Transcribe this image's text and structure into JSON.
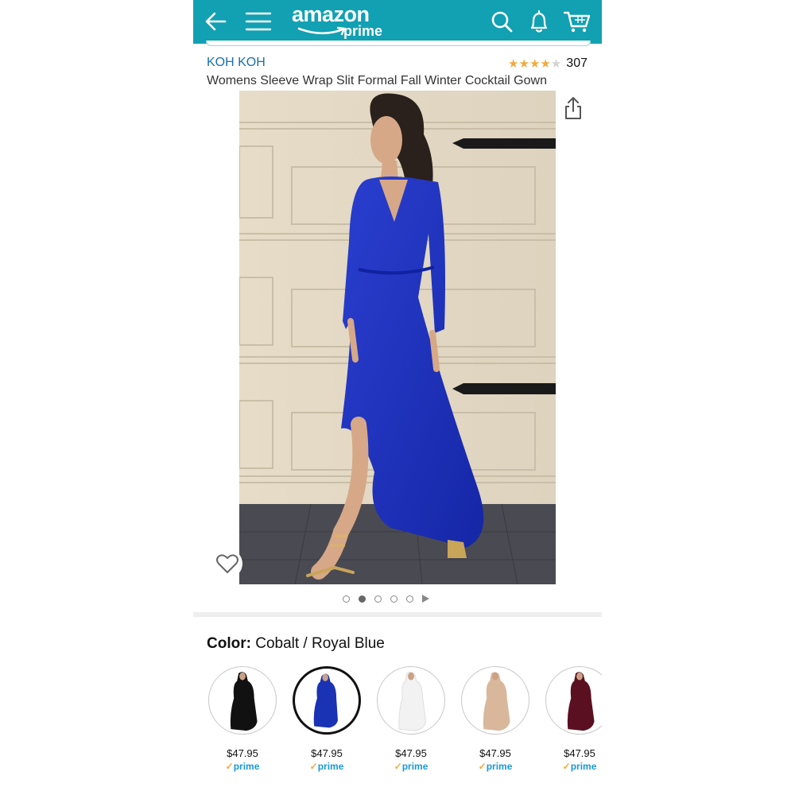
{
  "header": {
    "logo_word": "amazon",
    "logo_sub": "prime",
    "icons": [
      "back-arrow-icon",
      "menu-icon",
      "search-icon",
      "bell-icon",
      "cart-icon"
    ],
    "bg_color": "#12a0b3"
  },
  "product": {
    "brand": "KOH KOH",
    "rating_stars": 4,
    "rating_max": 5,
    "review_count": "307",
    "title": "Womens Sleeve Wrap Slit Formal Fall Winter Cocktail Gown",
    "image_pager": {
      "count": 5,
      "active_index": 1,
      "has_video": true
    }
  },
  "color": {
    "label": "Color:",
    "selected": "Cobalt / Royal Blue"
  },
  "swatches": [
    {
      "price": "$47.95",
      "prime_tick": "✓",
      "prime": "prime",
      "dress_color": "#111111",
      "selected": false
    },
    {
      "price": "$47.95",
      "prime_tick": "✓",
      "prime": "prime",
      "dress_color": "#1a32b4",
      "selected": true
    },
    {
      "price": "$47.95",
      "prime_tick": "✓",
      "prime": "prime",
      "dress_color": "#f4f4f4",
      "selected": false
    },
    {
      "price": "$47.95",
      "prime_tick": "✓",
      "prime": "prime",
      "dress_color": "#d9b79b",
      "selected": false
    },
    {
      "price": "$47.95",
      "prime_tick": "✓",
      "prime": "prime",
      "dress_color": "#5a1020",
      "selected": false
    }
  ]
}
